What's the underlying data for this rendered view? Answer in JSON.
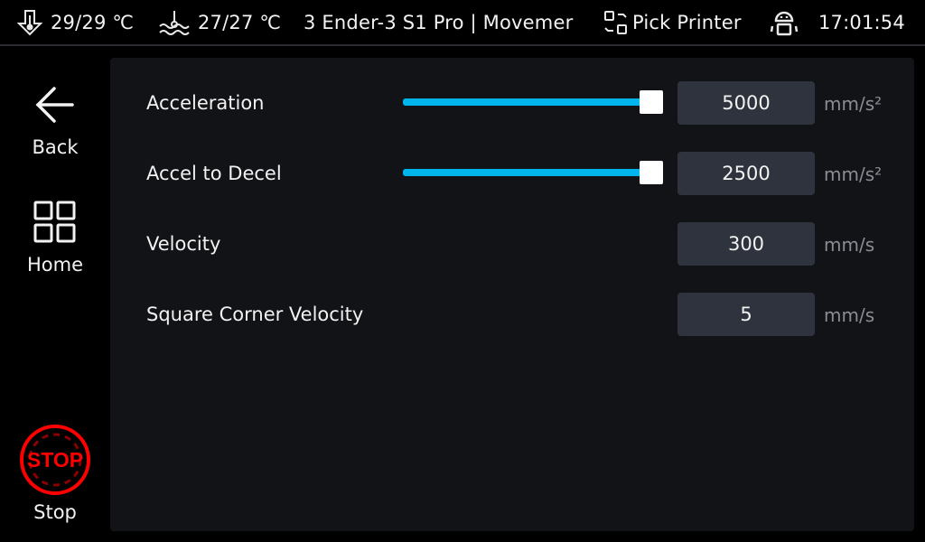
{
  "topbar": {
    "extruder_temp": "29/29 ℃",
    "bed_temp": "27/27 ℃",
    "title": "3 Ender-3 S1 Pro | Movemer",
    "pick_printer_label": "Pick Printer",
    "time": "17:01:54",
    "icons": {
      "extruder": "extruder-thermometer-icon",
      "bed": "heated-bed-icon",
      "pick_printer": "swap-printer-icon",
      "robot": "robot-icon"
    }
  },
  "sidebar": {
    "back_label": "Back",
    "home_label": "Home",
    "stop_label": "Stop",
    "stop_icon_text": "STOP",
    "stop_color": "#ff0000"
  },
  "settings": {
    "rows": [
      {
        "label": "Acceleration",
        "value": "5000",
        "unit": "mm/s²",
        "has_slider": true,
        "slider_fraction": 1.0
      },
      {
        "label": "Accel to Decel",
        "value": "2500",
        "unit": "mm/s²",
        "has_slider": true,
        "slider_fraction": 1.0
      },
      {
        "label": "Velocity",
        "value": "300",
        "unit": "mm/s",
        "has_slider": false
      },
      {
        "label": "Square Corner Velocity",
        "value": "5",
        "unit": "mm/s",
        "has_slider": false
      }
    ]
  },
  "colors": {
    "accent": "#00b5ec",
    "panel": "#121317",
    "value_box": "#2f333d",
    "unit_text": "#8a8d94"
  }
}
